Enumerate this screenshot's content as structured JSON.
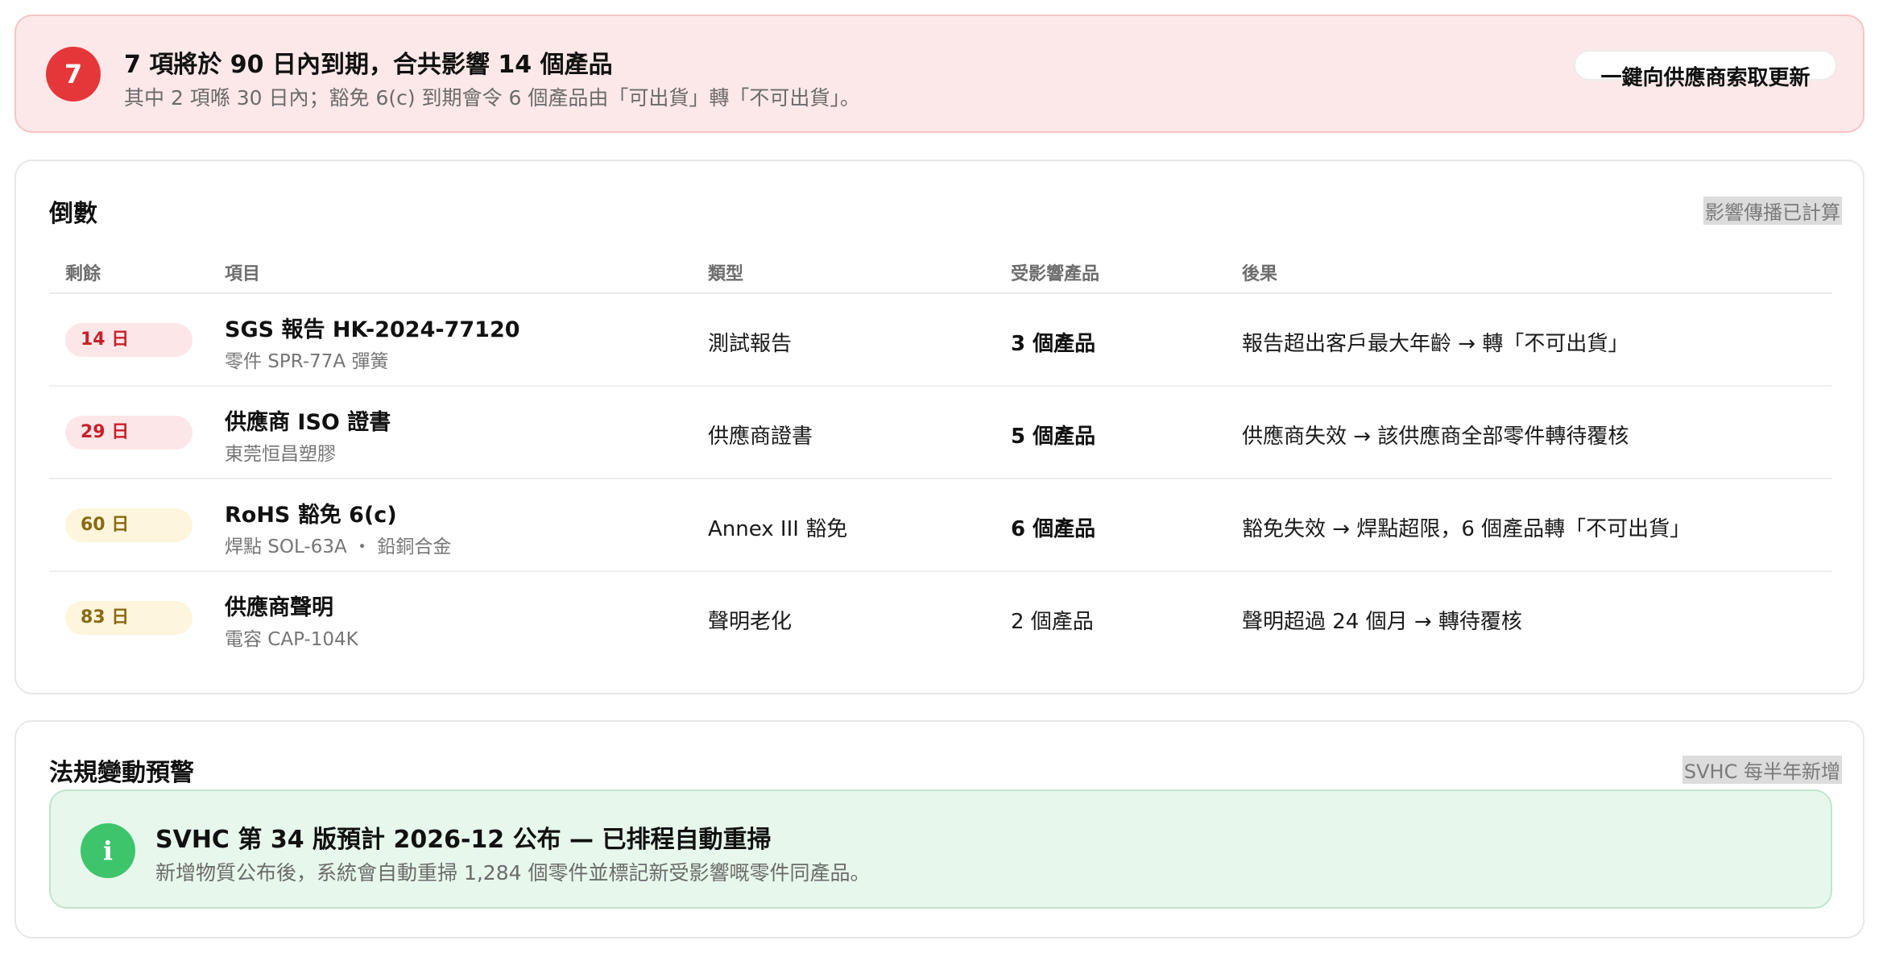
{
  "alert": {
    "count": "7",
    "title": "7 項將於 90 日內到期，合共影響 14 個產品",
    "subtitle": "其中 2 項喺 30 日內；豁免 6(c) 到期會令 6 個產品由「可出貨」轉「不可出貨」。",
    "action_label": "一鍵向供應商索取更新",
    "colors": {
      "background": "#fce8e8",
      "badge": "#e5373a"
    }
  },
  "countdown": {
    "title": "倒數",
    "meta": "影響傳播已計算",
    "columns": {
      "remaining": "剩餘",
      "item": "項目",
      "type": "類型",
      "products": "受影響產品",
      "consequence": "後果"
    },
    "rows": [
      {
        "remaining": "14 日",
        "urgency": "red",
        "item": "SGS 報告 HK-2024-77120",
        "item_sub": "零件 SPR-77A 彈簧",
        "type": "測試報告",
        "products": "3 個產品",
        "products_bold": true,
        "consequence": "報告超出客戶最大年齡 → 轉「不可出貨」"
      },
      {
        "remaining": "29 日",
        "urgency": "red",
        "item": "供應商 ISO 證書",
        "item_sub": "東莞恒昌塑膠",
        "type": "供應商證書",
        "products": "5 個產品",
        "products_bold": true,
        "consequence": "供應商失效 → 該供應商全部零件轉待覆核"
      },
      {
        "remaining": "60 日",
        "urgency": "amber",
        "item": "RoHS 豁免 6(c)",
        "item_sub": "焊點 SOL-63A ・ 鉛銅合金",
        "type": "Annex III 豁免",
        "products": "6 個產品",
        "products_bold": true,
        "consequence": "豁免失效 → 焊點超限，6 個產品轉「不可出貨」"
      },
      {
        "remaining": "83 日",
        "urgency": "amber",
        "item": "供應商聲明",
        "item_sub": "電容 CAP-104K",
        "type": "聲明老化",
        "products": "2 個產品",
        "products_bold": false,
        "consequence": "聲明超過 24 個月 → 轉待覆核"
      }
    ],
    "colors": {
      "red_pill": "#fde6e7",
      "red_text": "#c8202a",
      "amber_pill": "#fdf5dc",
      "amber_text": "#8a6a12"
    }
  },
  "regulation": {
    "title": "法規變動預警",
    "meta": "SVHC 每半年新增",
    "info_icon": "i",
    "info_title": "SVHC 第 34 版預計 2026-12 公布 — 已排程自動重掃",
    "info_text": "新增物質公布後，系統會自動重掃 1,284 個零件並標記新受影響嘅零件同產品。",
    "colors": {
      "background": "#e7f7ec",
      "icon": "#3ec46b"
    }
  }
}
